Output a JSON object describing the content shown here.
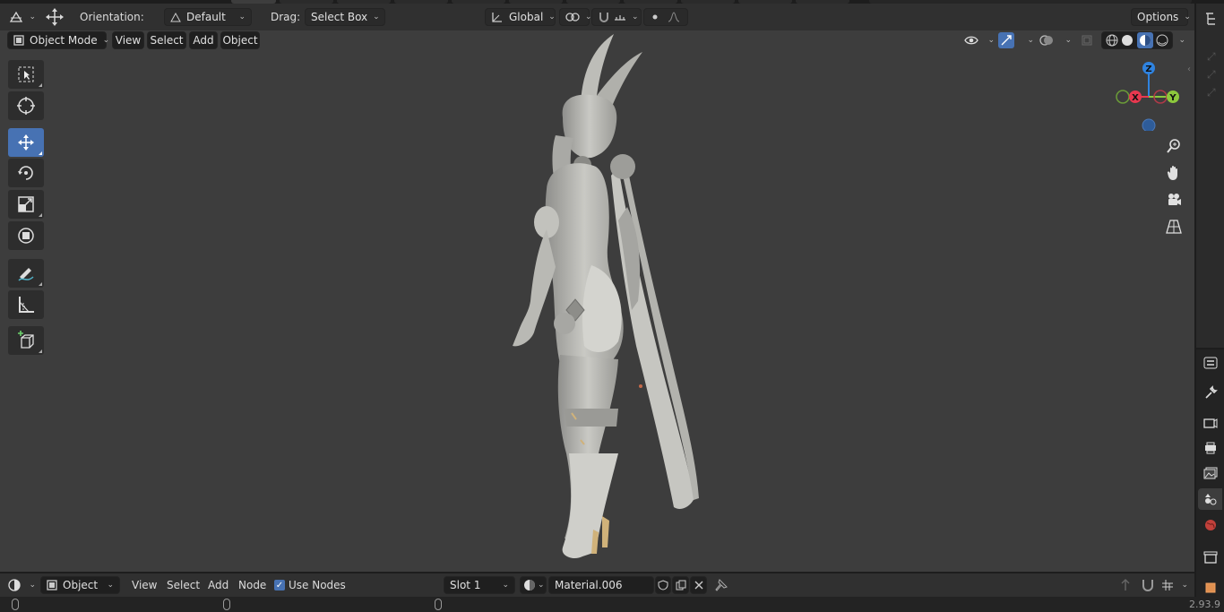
{
  "colors": {
    "accent": "#4772b3",
    "viewport": "#3d3d3d",
    "header": "#303030",
    "axis_x": "#e8384f",
    "axis_y": "#8cc83c",
    "axis_z": "#2f83e0"
  },
  "toolbar": {
    "orientation_label": "Orientation:",
    "orientation_value": "Default",
    "drag_label": "Drag:",
    "drag_value": "Select Box",
    "transform_orientation": "Global",
    "options_label": "Options"
  },
  "viewport_header": {
    "mode": "Object Mode",
    "menus": [
      "View",
      "Select",
      "Add",
      "Object"
    ]
  },
  "gizmo": {
    "x": "X",
    "y": "Y",
    "z": "Z"
  },
  "tools": [
    "select-box-tool",
    "cursor-tool",
    "move-tool",
    "rotate-tool",
    "scale-tool",
    "transform-tool",
    "annotate-tool",
    "measure-tool",
    "add-cube-tool"
  ],
  "node_header": {
    "editor_type": "Object",
    "menus": [
      "View",
      "Select",
      "Add",
      "Node"
    ],
    "use_nodes_label": "Use Nodes",
    "use_nodes_checked": true,
    "slot": "Slot 1",
    "material": "Material.006"
  },
  "status": {
    "version": "2.93.9"
  }
}
